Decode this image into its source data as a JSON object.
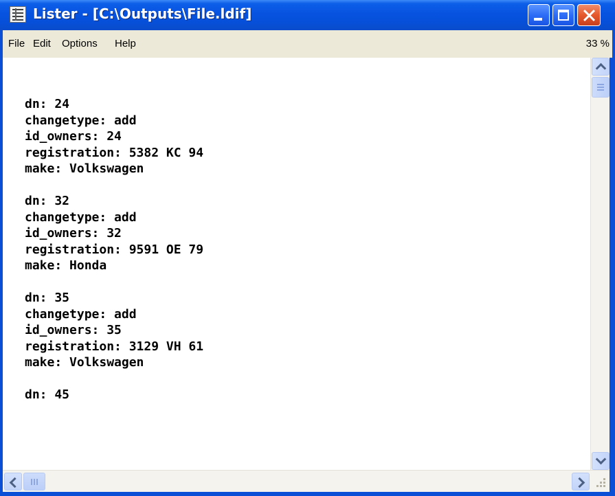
{
  "window": {
    "title": "Lister - [C:\\Outputs\\File.ldif]",
    "controls": [
      "minimize",
      "maximize",
      "close"
    ]
  },
  "menu": {
    "items": [
      "File",
      "Edit",
      "Options",
      "Help"
    ],
    "zoom": "33 %"
  },
  "content": {
    "lines": [
      "dn: 24",
      "changetype: add",
      "id_owners: 24",
      "registration: 5382 KC 94",
      "make: Volkswagen",
      "",
      "dn: 32",
      "changetype: add",
      "id_owners: 32",
      "registration: 9591 OE 79",
      "make: Honda",
      "",
      "dn: 35",
      "changetype: add",
      "id_owners: 35",
      "registration: 3129 VH 61",
      "make: Volkswagen",
      "",
      "dn: 45"
    ]
  },
  "colors": {
    "titlebar": "#0753e0",
    "close_button": "#e5592c",
    "menubar": "#ece9d8",
    "content_bg": "#ffffff",
    "text": "#000000"
  },
  "icons": {
    "app": "lister-app-icon",
    "minimize": "minimize-icon",
    "maximize": "maximize-icon",
    "close": "close-icon",
    "scroll_up": "chevron-up-icon",
    "scroll_down": "chevron-down-icon",
    "scroll_left": "chevron-left-icon",
    "scroll_right": "chevron-right-icon"
  }
}
